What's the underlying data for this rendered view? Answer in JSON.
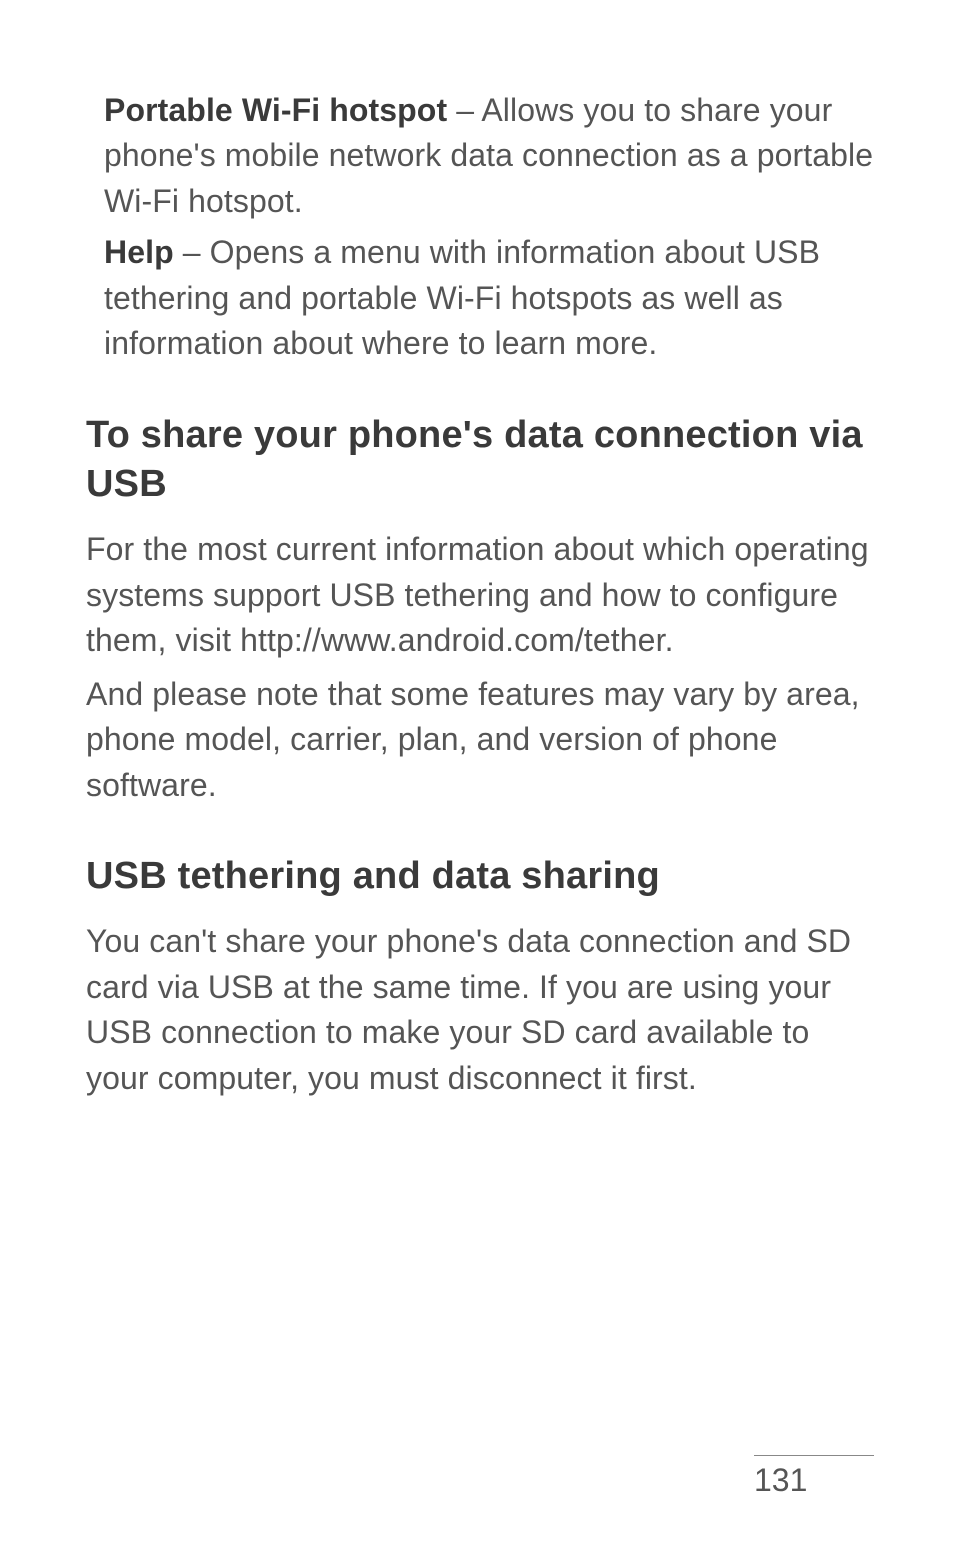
{
  "blocks": {
    "hotspot": {
      "label": "Portable Wi-Fi hotspot",
      "text": " – Allows you to share your phone's mobile network data connection as a portable Wi-Fi hotspot."
    },
    "help": {
      "label": "Help",
      "text": " – Opens a menu with information about USB tethering and portable Wi-Fi hotspots as well as information about where to learn more."
    }
  },
  "section1": {
    "heading": "To share your phone's data connection via USB",
    "para1": "For the most current information about which operating systems support USB tethering and how to configure them, visit http://www.android.com/tether.",
    "para2": "And please note that some features may vary by area, phone model, carrier, plan, and version of phone software."
  },
  "section2": {
    "heading": "USB tethering and data sharing",
    "para1": "You can't share your phone's data connection and SD card via USB at the same time. If you are using your USB connection to make your SD card available to your computer, you must disconnect it first."
  },
  "page_number": "131"
}
